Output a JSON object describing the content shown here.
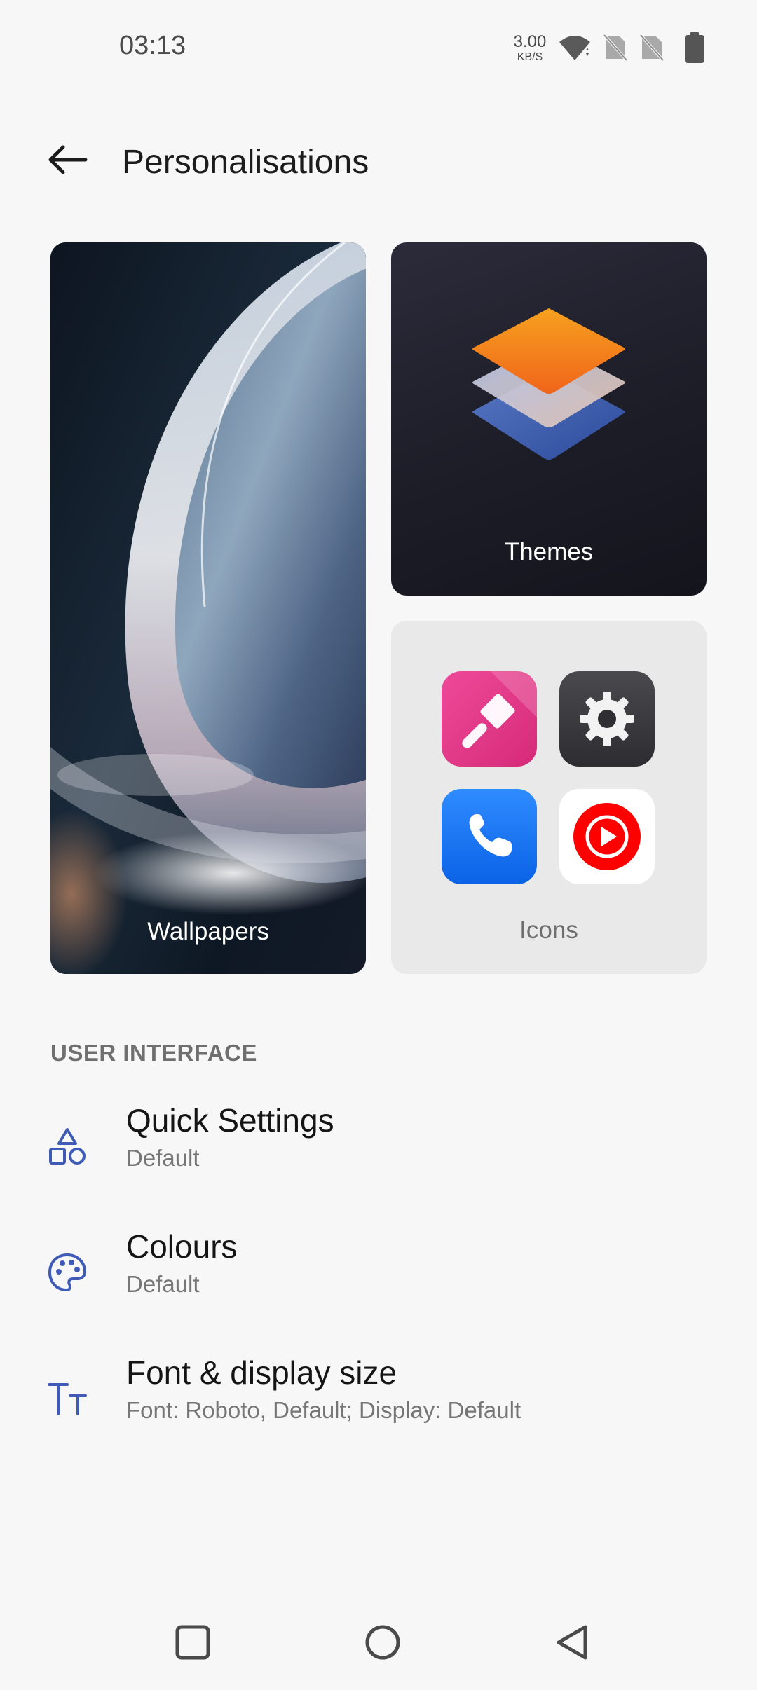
{
  "status_bar": {
    "time": "03:13",
    "net_speed_value": "3.00",
    "net_speed_unit": "KB/S",
    "icons": [
      "wifi-icon",
      "no-sim-icon",
      "no-sim-icon",
      "battery-icon"
    ]
  },
  "header": {
    "back_icon": "arrow-left-icon",
    "title": "Personalisations"
  },
  "cards": {
    "wallpapers": {
      "label": "Wallpapers"
    },
    "themes": {
      "label": "Themes",
      "icon": "layers-icon"
    },
    "icons": {
      "label": "Icons",
      "tiles": [
        "brush-app-icon",
        "settings-app-icon",
        "phone-app-icon",
        "youtube-music-app-icon"
      ]
    }
  },
  "section": {
    "header": "USER INTERFACE",
    "items": [
      {
        "title": "Quick Settings",
        "subtitle": "Default",
        "icon": "shapes-icon"
      },
      {
        "title": "Colours",
        "subtitle": "Default",
        "icon": "palette-icon"
      },
      {
        "title": "Font & display size",
        "subtitle": "Font: Roboto, Default; Display: Default",
        "icon": "text-size-icon"
      }
    ]
  },
  "nav_bar": {
    "buttons": [
      "recents-square-icon",
      "home-circle-icon",
      "back-triangle-icon"
    ]
  },
  "colors": {
    "accent": "#3f5bb5",
    "background": "#f7f7f7"
  }
}
